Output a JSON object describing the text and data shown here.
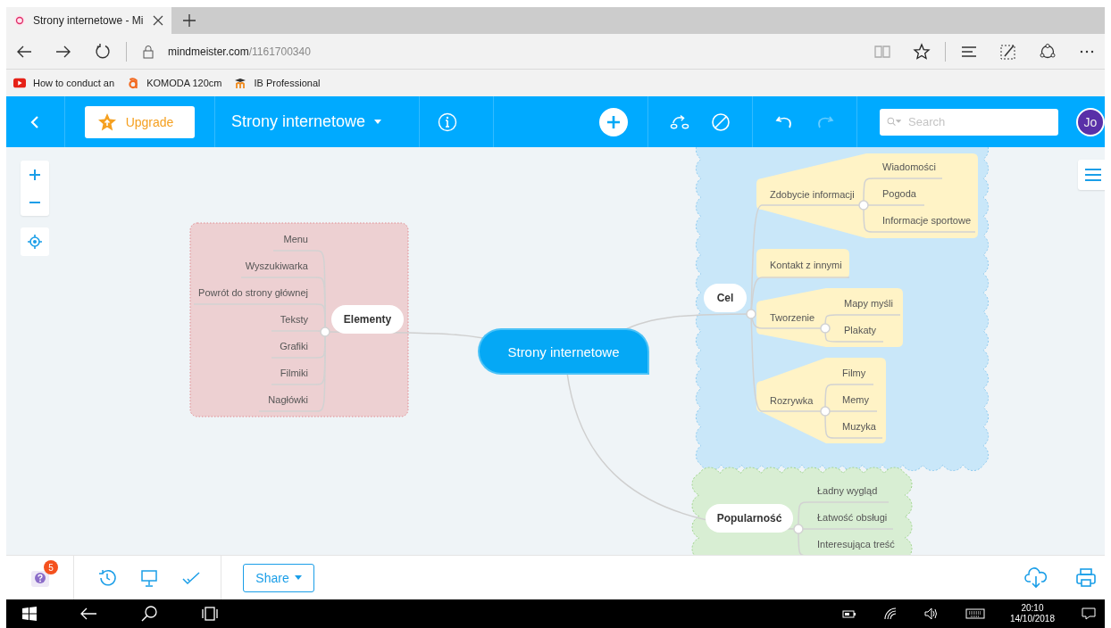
{
  "browser": {
    "tab": {
      "title": "Strony internetowe - Mi"
    },
    "address": {
      "domain": "mindmeister.com",
      "path": "/1161700340"
    },
    "bookmarks": [
      {
        "label": "How to conduct an",
        "kind": "video"
      },
      {
        "label": "KOMODA 120cm",
        "kind": "shop"
      },
      {
        "label": "IB Professional",
        "kind": "school"
      }
    ]
  },
  "toolbar": {
    "upgrade": "Upgrade",
    "map_title": "Strony internetowe",
    "undo": {
      "disabled": false
    },
    "redo": {
      "disabled": true
    },
    "search": {
      "placeholder": "Search"
    },
    "avatar": "Jo"
  },
  "mindmap": {
    "root": "Strony internetowe",
    "branches": [
      {
        "label": "Elementy",
        "kind": "box",
        "color": "#edd0d2",
        "children": [
          {
            "label": "Menu"
          },
          {
            "label": "Wyszukiwarka"
          },
          {
            "label": "Powrót do strony głównej"
          },
          {
            "label": "Teksty"
          },
          {
            "label": "Grafiki"
          },
          {
            "label": "Filmiki"
          },
          {
            "label": "Nagłówki"
          }
        ]
      },
      {
        "label": "Cel",
        "kind": "cloud",
        "color": "#c9e7f9",
        "children": [
          {
            "label": "Zdobycie informacji",
            "children": [
              {
                "label": "Wiadomości"
              },
              {
                "label": "Pogoda"
              },
              {
                "label": "Informacje sportowe"
              }
            ]
          },
          {
            "label": "Kontakt z innymi"
          },
          {
            "label": "Tworzenie",
            "children": [
              {
                "label": "Mapy myśli"
              },
              {
                "label": "Plakaty"
              }
            ]
          },
          {
            "label": "Rozrywka",
            "children": [
              {
                "label": "Filmy"
              },
              {
                "label": "Memy"
              },
              {
                "label": "Muzyka"
              }
            ]
          }
        ]
      },
      {
        "label": "Popularność",
        "kind": "cloud",
        "color": "#d8eed3",
        "children": [
          {
            "label": "Ładny wygląd"
          },
          {
            "label": "Łatwość obsługi"
          },
          {
            "label": "Interesująca treść"
          }
        ]
      }
    ]
  },
  "bottom_bar": {
    "notifications": "5",
    "share": "Share"
  },
  "taskbar": {
    "time": "20:10",
    "date": "14/10/2018"
  }
}
